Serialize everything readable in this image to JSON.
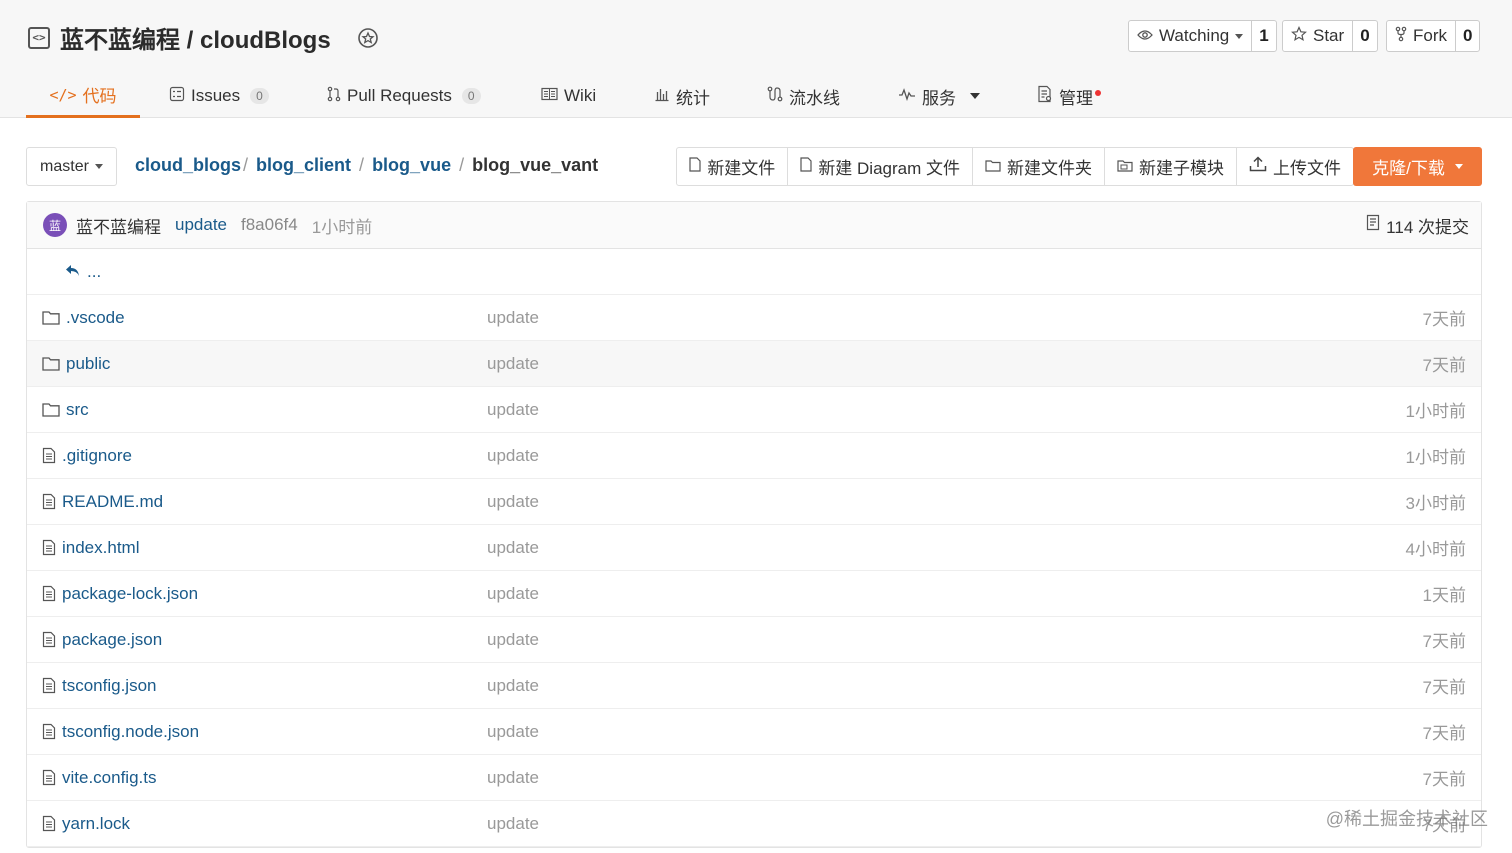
{
  "repo": {
    "owner": "蓝不蓝编程",
    "separator": " / ",
    "name": "cloudBlogs"
  },
  "actions": {
    "watch": {
      "label": "Watching",
      "count": "1"
    },
    "star": {
      "label": "Star",
      "count": "0"
    },
    "fork": {
      "label": "Fork",
      "count": "0"
    }
  },
  "tabs": [
    {
      "label": "代码"
    },
    {
      "label": "Issues",
      "count": "0"
    },
    {
      "label": "Pull Requests",
      "count": "0"
    },
    {
      "label": "Wiki"
    },
    {
      "label": "统计"
    },
    {
      "label": "流水线"
    },
    {
      "label": "服务"
    },
    {
      "label": "管理"
    }
  ],
  "branch": "master",
  "breadcrumb": {
    "p1": "cloud_blogs",
    "p2": "blog_client",
    "p3": "blog_vue",
    "current": "blog_vue_vant",
    "sep": "/"
  },
  "buttons": {
    "new_file": "新建文件",
    "new_diagram": "新建 Diagram 文件",
    "new_folder": "新建文件夹",
    "new_submodule": "新建子模块",
    "upload": "上传文件",
    "clone": "克隆/下载"
  },
  "commit": {
    "avatar_text": "蓝",
    "author": "蓝不蓝编程",
    "message": "update",
    "sha": "f8a06f4",
    "time": "1小时前",
    "count": "114 次提交"
  },
  "parent_dir": "...",
  "files": [
    {
      "name": ".vscode",
      "type": "folder",
      "message": "update",
      "time": "7天前"
    },
    {
      "name": "public",
      "type": "folder",
      "message": "update",
      "time": "7天前"
    },
    {
      "name": "src",
      "type": "folder",
      "message": "update",
      "time": "1小时前"
    },
    {
      "name": ".gitignore",
      "type": "file",
      "message": "update",
      "time": "1小时前"
    },
    {
      "name": "README.md",
      "type": "file",
      "message": "update",
      "time": "3小时前"
    },
    {
      "name": "index.html",
      "type": "file",
      "message": "update",
      "time": "4小时前"
    },
    {
      "name": "package-lock.json",
      "type": "file",
      "message": "update",
      "time": "1天前"
    },
    {
      "name": "package.json",
      "type": "file",
      "message": "update",
      "time": "7天前"
    },
    {
      "name": "tsconfig.json",
      "type": "file",
      "message": "update",
      "time": "7天前"
    },
    {
      "name": "tsconfig.node.json",
      "type": "file",
      "message": "update",
      "time": "7天前"
    },
    {
      "name": "vite.config.ts",
      "type": "file",
      "message": "update",
      "time": "7天前"
    },
    {
      "name": "yarn.lock",
      "type": "file",
      "message": "update",
      "time": "7天前"
    }
  ],
  "watermark": "@稀土掘金技术社区",
  "colors": {
    "accent": "#e4701e",
    "clone_bg": "#f0773a",
    "link": "#1a5a8a"
  }
}
